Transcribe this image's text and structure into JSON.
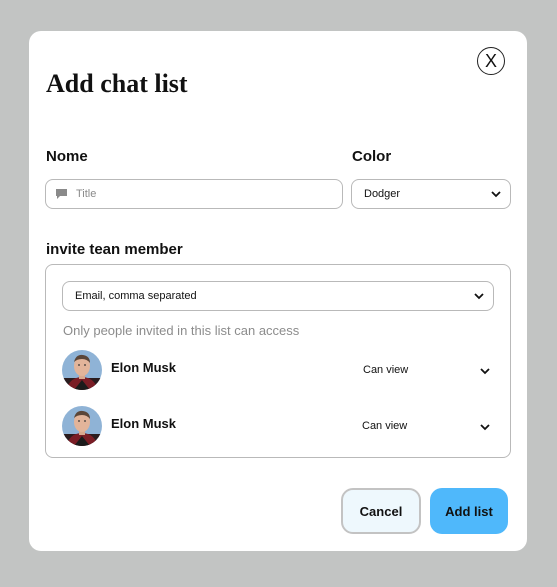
{
  "dialog": {
    "title": "Add chat list",
    "close_label": "X"
  },
  "fields": {
    "name_label": "Nome",
    "title_placeholder": "Title",
    "color_label": "Color",
    "color_value": "Dodger",
    "invite_label": "invite tean member",
    "email_value": "Email, comma separated",
    "access_note": "Only people invited in this list can access"
  },
  "members": [
    {
      "name": "Elon Musk",
      "permission": "Can view"
    },
    {
      "name": "Elon Musk",
      "permission": "Can view"
    }
  ],
  "actions": {
    "cancel_label": "Cancel",
    "add_label": "Add list"
  },
  "colors": {
    "backdrop": "#c2c4c3",
    "primary": "#4fb8fb",
    "secondary_bg": "#eef8fd"
  },
  "icons": {
    "title_field": "chat-bubble-icon",
    "dropdown": "chevron-down-icon",
    "close": "close-icon"
  }
}
